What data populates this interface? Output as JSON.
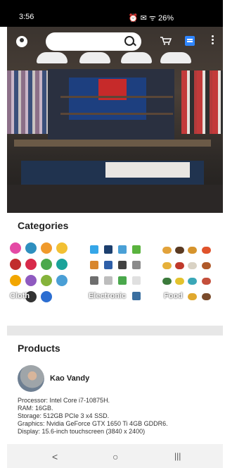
{
  "status_bar": {
    "time": "3:56",
    "indicators": "⏰ ✉ ᯤ 26%"
  },
  "app_bar": {
    "search_placeholder": ""
  },
  "categories": {
    "title": "Categories",
    "items": [
      {
        "label": "Cloth"
      },
      {
        "label": "Electronic"
      },
      {
        "label": "Food"
      }
    ]
  },
  "products": {
    "title": "Products",
    "item": {
      "user_name": "Kao Vandy",
      "details": [
        "Processor: Intel Core i7-10875H.",
        "RAM: 16GB.",
        "Storage: 512GB PCIe 3 x4 SSD.",
        "Graphics: Nvidia GeForce GTX 1650 Ti 4GB GDDR6.",
        "Display: 15.6-inch touchscreen (3840 x 2400)"
      ]
    }
  },
  "nav": {
    "back": "<",
    "home": "○",
    "recents": "|||"
  },
  "colors": {
    "accent": "#2f86ff",
    "divider": "#e7e7e7"
  }
}
